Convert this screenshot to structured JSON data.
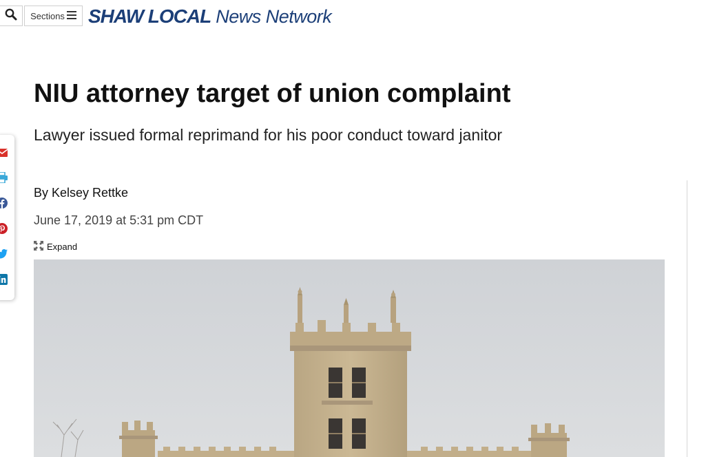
{
  "header": {
    "sections_label": "Sections",
    "logo_brand": "SHAW LOCAL",
    "logo_network": "News Network",
    "icons": {
      "search": "search-icon",
      "menu": "hamburger-menu-icon"
    }
  },
  "article": {
    "headline": "NIU attorney target of union complaint",
    "subhead": "Lawyer issued formal reprimand for his poor conduct toward janitor",
    "byline": "By Kelsey Rettke",
    "date": "June 17, 2019 at 5:31 pm CDT",
    "expand_label": "Expand"
  },
  "share": {
    "items": [
      {
        "icon": "email-icon",
        "color": "#d9322b"
      },
      {
        "icon": "print-icon",
        "color": "#3aa8d8"
      },
      {
        "icon": "facebook-icon",
        "color": "#3b5998"
      },
      {
        "icon": "pinterest-icon",
        "color": "#cb2027"
      },
      {
        "icon": "twitter-icon",
        "color": "#1da1f2"
      },
      {
        "icon": "linkedin-icon",
        "color": "#0e76a8"
      }
    ]
  },
  "colors": {
    "brand": "#1c3f78",
    "sky": "#d4d6d9",
    "stone": "#c3b08d"
  }
}
